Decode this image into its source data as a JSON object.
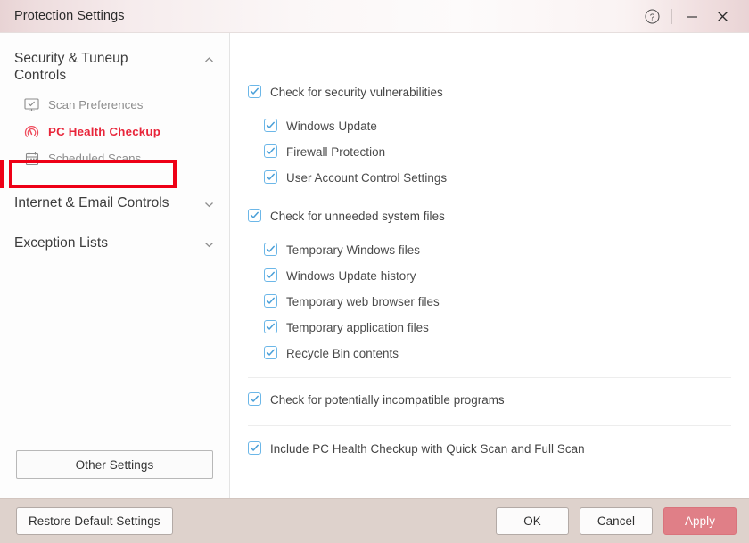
{
  "window": {
    "title": "Protection Settings",
    "accent_red": "#e8253a",
    "annotation_red": "#ee0016",
    "apply_button_color": "#e07f87",
    "footer_color": "#ded2cc",
    "checkbox_blue": "#6cb7e8"
  },
  "titlebar": {
    "title": "Protection Settings",
    "help_icon": "help-circle-icon",
    "minimize_icon": "minimize-icon",
    "close_icon": "close-icon"
  },
  "sidebar": {
    "groups": [
      {
        "label": "Security & Tuneup Controls",
        "expanded": true,
        "chevron": "chevron-up-icon",
        "items": [
          {
            "label": "Scan Preferences",
            "icon": "monitor-check-icon",
            "active": false
          },
          {
            "label": "PC Health Checkup",
            "icon": "gauge-icon",
            "active": true
          },
          {
            "label": "Scheduled Scans",
            "icon": "calendar-icon",
            "active": false
          }
        ]
      },
      {
        "label": "Internet & Email Controls",
        "expanded": false,
        "chevron": "chevron-down-icon",
        "items": []
      },
      {
        "label": "Exception Lists",
        "expanded": false,
        "chevron": "chevron-down-icon",
        "items": []
      }
    ],
    "other_settings_label": "Other Settings"
  },
  "main": {
    "group1": {
      "label": "Check for security vulnerabilities",
      "checked": true,
      "children": [
        {
          "label": "Windows Update",
          "checked": true
        },
        {
          "label": "Firewall Protection",
          "checked": true
        },
        {
          "label": "User Account Control Settings",
          "checked": true
        }
      ]
    },
    "group2": {
      "label": "Check for unneeded system files",
      "checked": true,
      "children": [
        {
          "label": "Temporary Windows files",
          "checked": true
        },
        {
          "label": "Windows Update history",
          "checked": true
        },
        {
          "label": "Temporary web browser files",
          "checked": true
        },
        {
          "label": "Temporary application files",
          "checked": true
        },
        {
          "label": "Recycle Bin contents",
          "checked": true
        }
      ]
    },
    "row_incompatible": {
      "label": "Check for potentially incompatible programs",
      "checked": true
    },
    "row_include": {
      "label": "Include PC Health Checkup with Quick Scan and Full Scan",
      "checked": true
    }
  },
  "footer": {
    "restore_label": "Restore Default Settings",
    "ok_label": "OK",
    "cancel_label": "Cancel",
    "apply_label": "Apply"
  }
}
